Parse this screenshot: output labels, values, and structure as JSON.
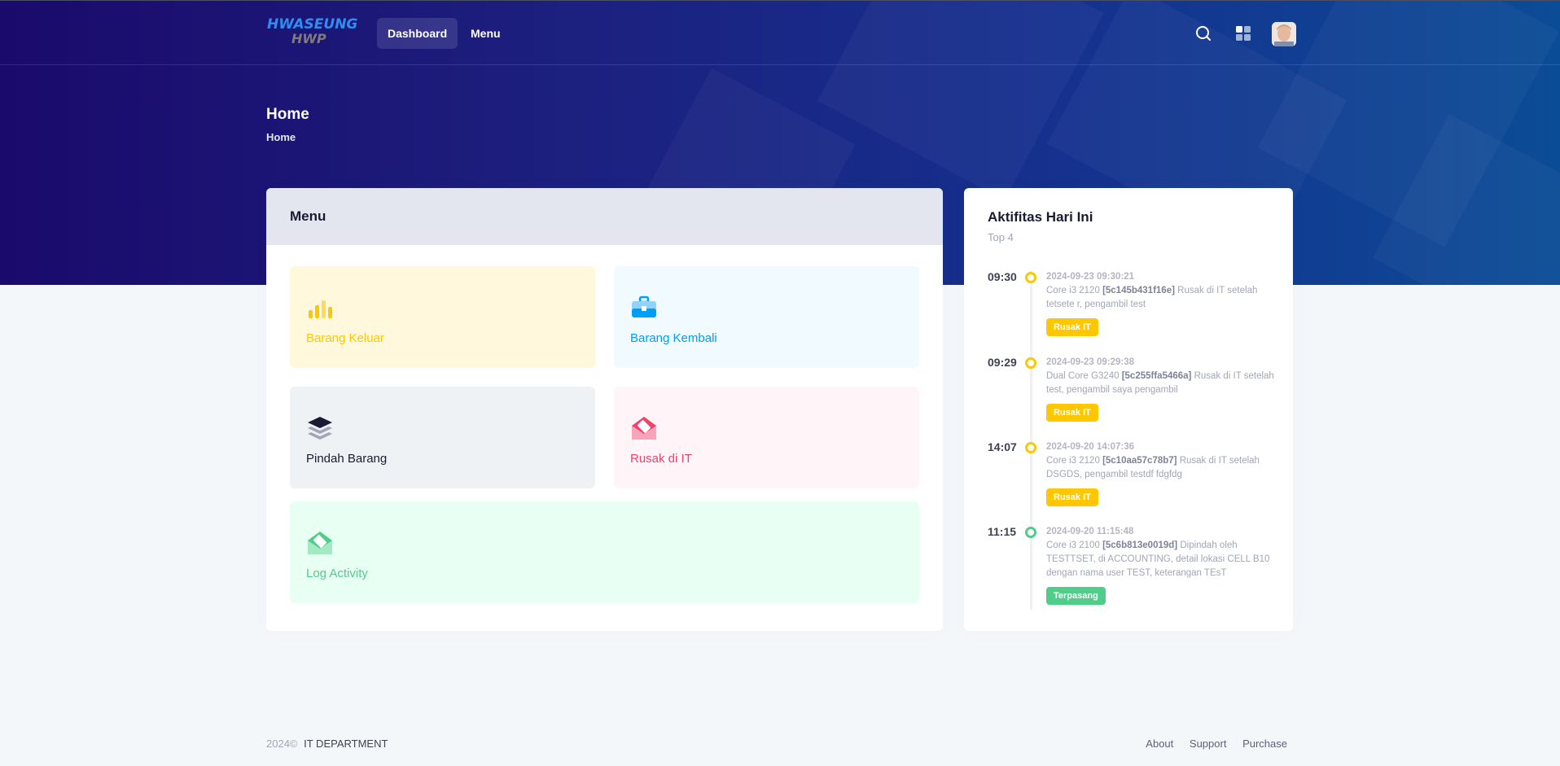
{
  "brand": {
    "line1": "HWASEUNG",
    "line2": "HWP"
  },
  "nav": {
    "dashboard": "Dashboard",
    "menu": "Menu"
  },
  "header_icons": [
    "search-icon",
    "apps-grid-icon",
    "avatar"
  ],
  "page": {
    "title": "Home",
    "breadcrumb": "Home"
  },
  "menu_card": {
    "title": "Menu",
    "tiles": [
      {
        "label": "Barang Keluar",
        "color": "#ffc700",
        "bg": "#fff8dd",
        "icon": "bar-chart-icon"
      },
      {
        "label": "Barang Kembali",
        "color": "#009ef7",
        "bg": "#f1faff",
        "icon": "briefcase-icon"
      },
      {
        "label": "Pindah Barang",
        "color": "#181c32",
        "bg": "#eff2f5",
        "icon": "layers-icon"
      },
      {
        "label": "Rusak di IT",
        "color": "#f1416c",
        "bg": "#fff5f8",
        "icon": "envelope-open-icon"
      },
      {
        "label": "Log Activity",
        "color": "#50cd89",
        "bg": "#e8fff3",
        "icon": "envelope-open-icon"
      }
    ]
  },
  "activity": {
    "title": "Aktifitas Hari Ini",
    "subtitle": "Top 4",
    "items": [
      {
        "time": "09:30",
        "stamp": "2024-09-23 09:30:21",
        "prefix": "Core i3 2120",
        "code": "[5c145b431f16e]",
        "text": "Rusak di IT setelah tetsete r, pengambil test",
        "badge": "Rusak IT",
        "color": "#ffc700"
      },
      {
        "time": "09:29",
        "stamp": "2024-09-23 09:29:38",
        "prefix": "Dual Core G3240",
        "code": "[5c255ffa5466a]",
        "text": "Rusak di IT setelah test, pengambil saya pengambil",
        "badge": "Rusak IT",
        "color": "#ffc700"
      },
      {
        "time": "14:07",
        "stamp": "2024-09-20 14:07:36",
        "prefix": "Core i3 2120",
        "code": "[5c10aa57c78b7]",
        "text": "Rusak di IT setelah DSGDS, pengambil testdf fdgfdg",
        "badge": "Rusak IT",
        "color": "#ffc700"
      },
      {
        "time": "11:15",
        "stamp": "2024-09-20 11:15:48",
        "prefix": "Core i3 2100",
        "code": "[5c6b813e0019d]",
        "text": "Dipindah oleh TESTTSET, di ACCOUNTING, detail lokasi CELL B10 dengan nama user TEST, keterangan TEsT",
        "badge": "Terpasang",
        "color": "#50cd89"
      }
    ]
  },
  "footer": {
    "year": "2024©",
    "org": "IT DEPARTMENT",
    "links": [
      "About",
      "Support",
      "Purchase"
    ]
  }
}
